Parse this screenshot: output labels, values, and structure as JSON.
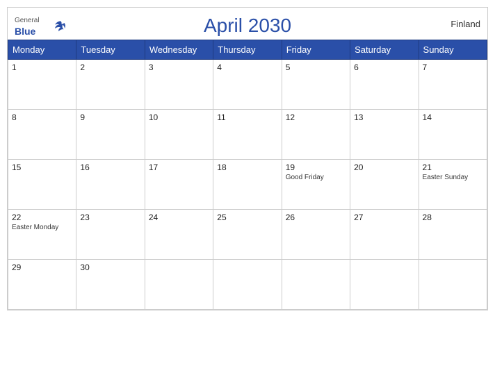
{
  "calendar": {
    "title": "April 2030",
    "country": "Finland",
    "days_of_week": [
      "Monday",
      "Tuesday",
      "Wednesday",
      "Thursday",
      "Friday",
      "Saturday",
      "Sunday"
    ],
    "weeks": [
      [
        {
          "date": "1",
          "holiday": ""
        },
        {
          "date": "2",
          "holiday": ""
        },
        {
          "date": "3",
          "holiday": ""
        },
        {
          "date": "4",
          "holiday": ""
        },
        {
          "date": "5",
          "holiday": ""
        },
        {
          "date": "6",
          "holiday": ""
        },
        {
          "date": "7",
          "holiday": ""
        }
      ],
      [
        {
          "date": "8",
          "holiday": ""
        },
        {
          "date": "9",
          "holiday": ""
        },
        {
          "date": "10",
          "holiday": ""
        },
        {
          "date": "11",
          "holiday": ""
        },
        {
          "date": "12",
          "holiday": ""
        },
        {
          "date": "13",
          "holiday": ""
        },
        {
          "date": "14",
          "holiday": ""
        }
      ],
      [
        {
          "date": "15",
          "holiday": ""
        },
        {
          "date": "16",
          "holiday": ""
        },
        {
          "date": "17",
          "holiday": ""
        },
        {
          "date": "18",
          "holiday": ""
        },
        {
          "date": "19",
          "holiday": "Good Friday"
        },
        {
          "date": "20",
          "holiday": ""
        },
        {
          "date": "21",
          "holiday": "Easter Sunday"
        }
      ],
      [
        {
          "date": "22",
          "holiday": "Easter Monday"
        },
        {
          "date": "23",
          "holiday": ""
        },
        {
          "date": "24",
          "holiday": ""
        },
        {
          "date": "25",
          "holiday": ""
        },
        {
          "date": "26",
          "holiday": ""
        },
        {
          "date": "27",
          "holiday": ""
        },
        {
          "date": "28",
          "holiday": ""
        }
      ],
      [
        {
          "date": "29",
          "holiday": ""
        },
        {
          "date": "30",
          "holiday": ""
        },
        {
          "date": "",
          "holiday": ""
        },
        {
          "date": "",
          "holiday": ""
        },
        {
          "date": "",
          "holiday": ""
        },
        {
          "date": "",
          "holiday": ""
        },
        {
          "date": "",
          "holiday": ""
        }
      ]
    ],
    "logo": {
      "general": "General",
      "blue": "Blue"
    }
  }
}
